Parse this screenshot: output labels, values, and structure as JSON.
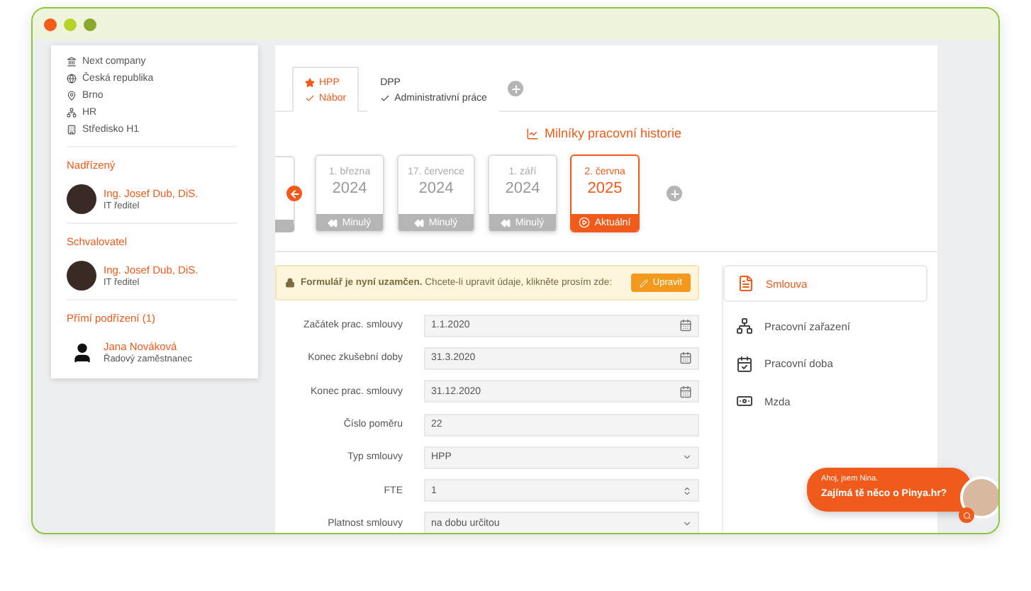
{
  "company_info": [
    {
      "kind": "company",
      "text": "Next company"
    },
    {
      "kind": "country",
      "text": "Česká republika"
    },
    {
      "kind": "city",
      "text": "Brno"
    },
    {
      "kind": "department",
      "text": "HR"
    },
    {
      "kind": "center",
      "text": "Středisko H1"
    }
  ],
  "sections": [
    {
      "title": "Nadřízený",
      "people": [
        {
          "name": "Ing. Josef Dub, DiS.",
          "role": "IT ředitel",
          "kind": "photo"
        }
      ]
    },
    {
      "title": "Schvalovatel",
      "people": [
        {
          "name": "Ing. Josef Dub, DiS.",
          "role": "IT ředitel",
          "kind": "photo"
        }
      ]
    },
    {
      "title": "Přímí podřízení (1)",
      "people": [
        {
          "name": "Jana Nováková",
          "role": "Řadový zaměstnanec",
          "kind": "silhouette"
        }
      ]
    }
  ],
  "tabs": [
    {
      "type": "HPP",
      "subtitle": "Nábor",
      "starred": true,
      "selected": true
    },
    {
      "type": "DPP",
      "subtitle": "Administrativní práce",
      "starred": false,
      "selected": false
    }
  ],
  "milestones_title": "Milníky pracovní historie",
  "milestones": [
    {
      "date": "1. března",
      "year": "2024",
      "status": "Minulý",
      "selected": false
    },
    {
      "date": "17. července",
      "year": "2024",
      "status": "Minulý",
      "selected": false
    },
    {
      "date": "1. září",
      "year": "2024",
      "status": "Minulý",
      "selected": false
    },
    {
      "date": "2. června",
      "year": "2025",
      "status": "Aktuální",
      "selected": true
    }
  ],
  "lock_banner": {
    "text": "**Formulář je nyní uzamčen.** Chcete-li upravit údaje, klikněte prosím zde:",
    "button": "Upravit"
  },
  "form": [
    {
      "label": "Začátek prac. smlouvy",
      "value": "1.1.2020",
      "kind": "date"
    },
    {
      "label": "Konec zkušební doby",
      "value": "31.3.2020",
      "kind": "date"
    },
    {
      "label": "Konec prac. smlouvy",
      "value": "31.12.2020",
      "kind": "date"
    },
    {
      "label": "Číslo poměru",
      "value": "22",
      "kind": "text"
    },
    {
      "label": "Typ smlouvy",
      "value": "HPP",
      "kind": "select"
    },
    {
      "label": "FTE",
      "value": "1",
      "kind": "number"
    },
    {
      "label": "Platnost smlouvy",
      "value": "na dobu určitou",
      "kind": "select"
    }
  ],
  "nav": [
    {
      "label": "Smlouva",
      "kind": "contract",
      "selected": true
    },
    {
      "label": "Pracovní zařazení",
      "kind": "position",
      "selected": false
    },
    {
      "label": "Pracovní doba",
      "kind": "hours",
      "selected": false
    },
    {
      "label": "Mzda",
      "kind": "salary",
      "selected": false
    }
  ],
  "chat": {
    "greeting": "Ahoj, jsem Nina.",
    "question": "Zajímá tě něco o Pinya.hr?"
  }
}
